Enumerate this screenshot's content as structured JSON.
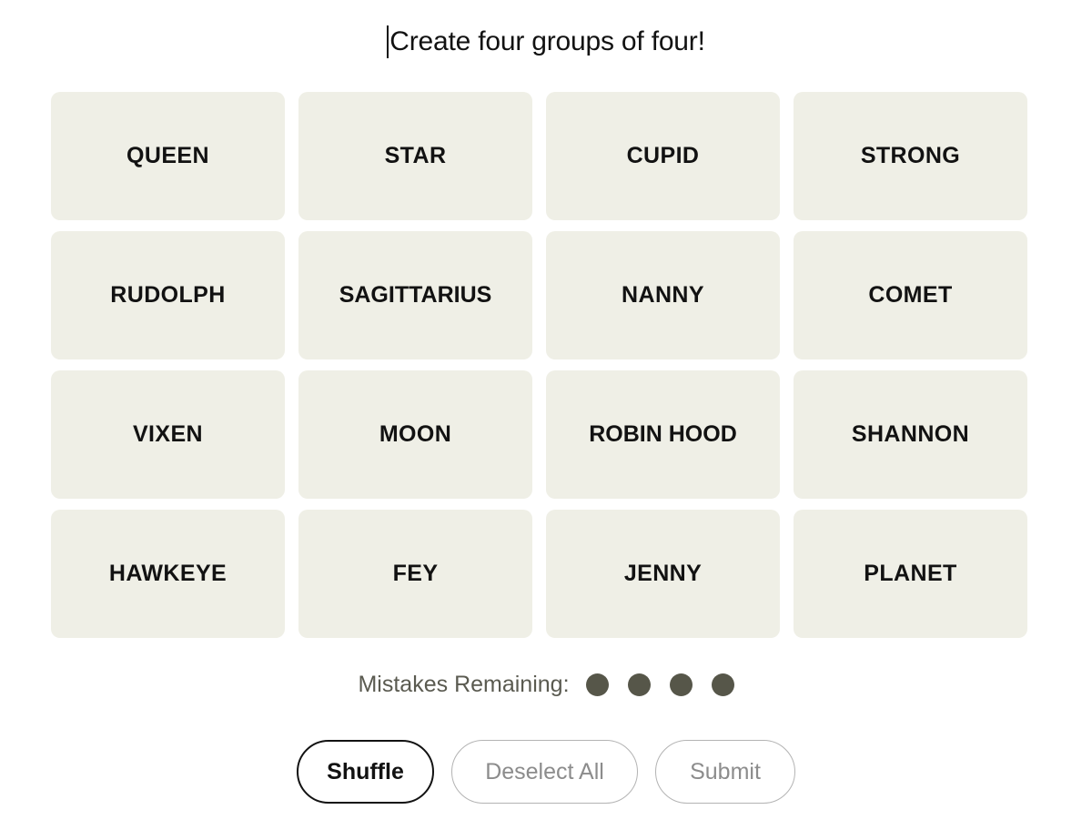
{
  "header": {
    "caret_visible": true,
    "title": "Create four groups of four!"
  },
  "board": {
    "rows": 4,
    "cols": 4,
    "tile_bg": "#EFEFE6",
    "tiles": [
      {
        "label": "QUEEN",
        "selected": false
      },
      {
        "label": "STAR",
        "selected": false
      },
      {
        "label": "CUPID",
        "selected": false
      },
      {
        "label": "STRONG",
        "selected": false
      },
      {
        "label": "RUDOLPH",
        "selected": false
      },
      {
        "label": "SAGITTARIUS",
        "selected": false
      },
      {
        "label": "NANNY",
        "selected": false
      },
      {
        "label": "COMET",
        "selected": false
      },
      {
        "label": "VIXEN",
        "selected": false
      },
      {
        "label": "MOON",
        "selected": false
      },
      {
        "label": "ROBIN HOOD",
        "selected": false
      },
      {
        "label": "SHANNON",
        "selected": false
      },
      {
        "label": "HAWKEYE",
        "selected": false
      },
      {
        "label": "FEY",
        "selected": false
      },
      {
        "label": "JENNY",
        "selected": false
      },
      {
        "label": "PLANET",
        "selected": false
      }
    ]
  },
  "mistakes": {
    "label": "Mistakes Remaining:",
    "remaining": 4,
    "dot_color": "#565649",
    "label_color": "#5A5A50"
  },
  "controls": {
    "shuffle": {
      "label": "Shuffle",
      "enabled": true
    },
    "deselect_all": {
      "label": "Deselect All",
      "enabled": false
    },
    "submit": {
      "label": "Submit",
      "enabled": false
    }
  }
}
